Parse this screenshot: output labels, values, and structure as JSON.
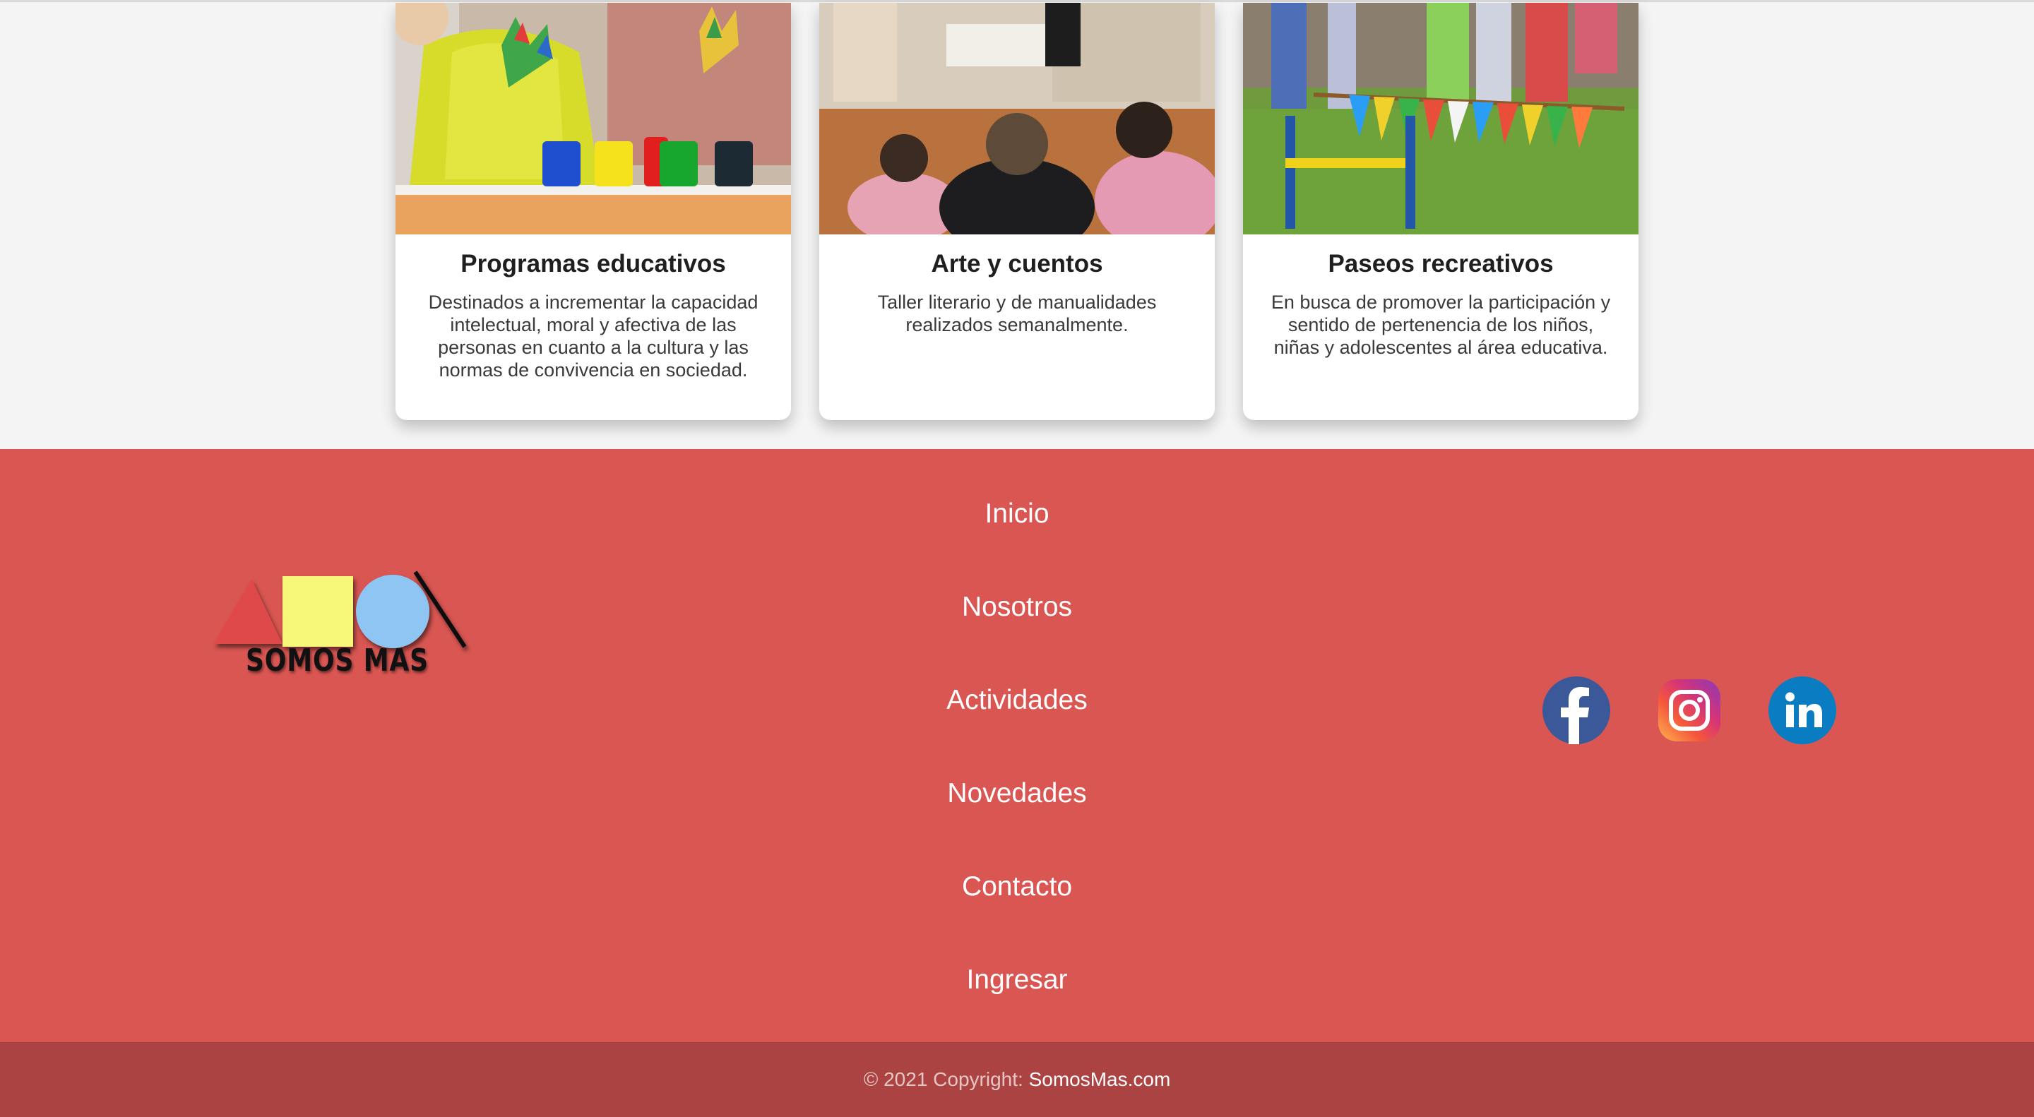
{
  "cards": [
    {
      "title": "Programas educativos",
      "text": "Destinados a incrementar la capacidad intelectual, moral y afectiva de las personas en cuanto a la cultura y las normas de convivencia en sociedad.",
      "image": "children-painting-hands"
    },
    {
      "title": "Arte y cuentos",
      "text": "Taller literario y de manualidades realizados semanalmente.",
      "image": "children-storytelling"
    },
    {
      "title": "Paseos recreativos",
      "text": "En busca de promover la participación y sentido de pertenencia de los niños, niñas y adolescentes al área educativa.",
      "image": "outdoor-bunting-playground"
    }
  ],
  "footer": {
    "logo_text": "SOMOS MAS",
    "nav": [
      "Inicio",
      "Nosotros",
      "Actividades",
      "Novedades",
      "Contacto",
      "Ingresar"
    ],
    "social": [
      "facebook-icon",
      "instagram-icon",
      "linkedin-icon"
    ],
    "copyright_prefix": "© 2021 Copyright:",
    "copyright_brand": "SomosMas.com"
  },
  "colors": {
    "footer_bg": "#d95652",
    "copyright_bg": "#aa4341",
    "page_bg": "#f4f4f4",
    "logo_triangle": "#e04a4a",
    "logo_square": "#f7f77a",
    "logo_circle": "#8ec5f2",
    "facebook": "#3b5998",
    "linkedin": "#0a7cc2"
  }
}
